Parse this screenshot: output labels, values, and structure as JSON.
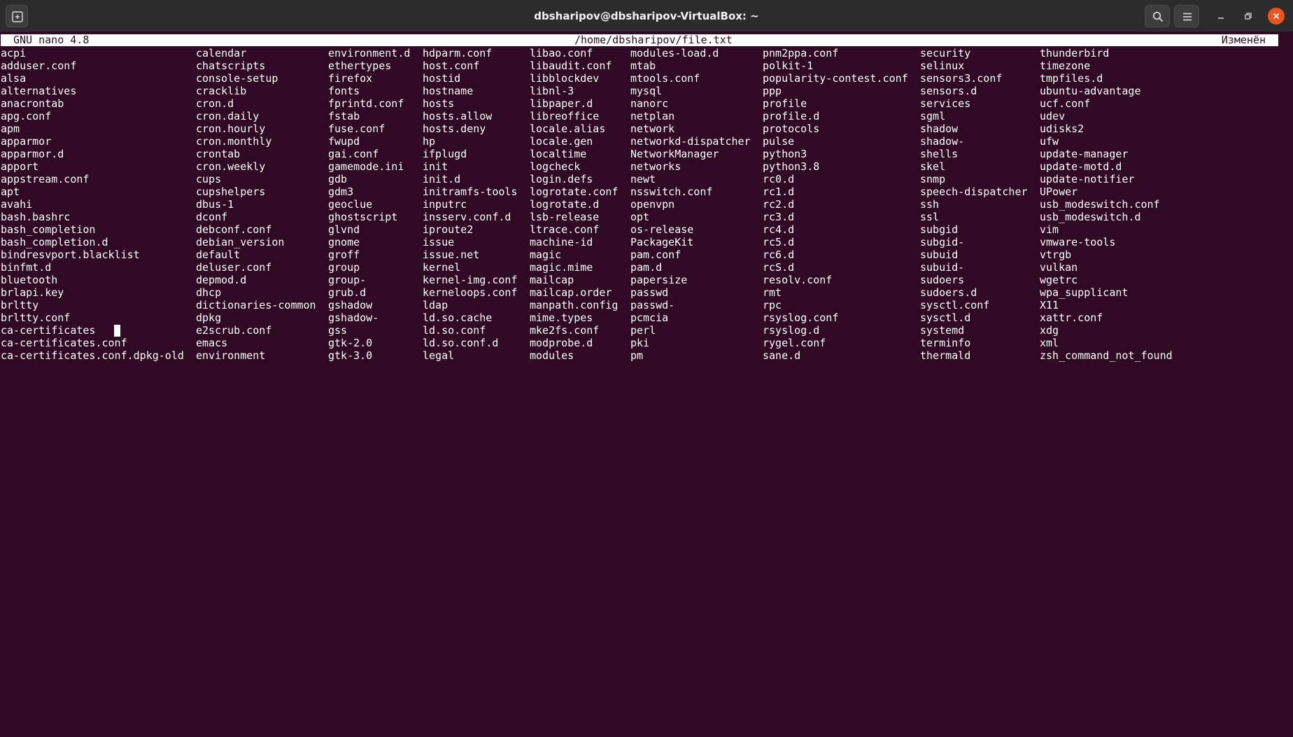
{
  "window": {
    "title": "dbsharipov@dbsharipov-VirtualBox: ~"
  },
  "nano": {
    "version": "GNU nano 4.8",
    "filename": "/home/dbsharipov/file.txt",
    "status": "Изменён"
  },
  "rows": [
    [
      "acpi",
      "calendar",
      "environment.d",
      "hdparm.conf",
      "libao.conf",
      "modules-load.d",
      "pnm2ppa.conf",
      "security",
      "thunderbird"
    ],
    [
      "adduser.conf",
      "chatscripts",
      "ethertypes",
      "host.conf",
      "libaudit.conf",
      "mtab",
      "polkit-1",
      "selinux",
      "timezone"
    ],
    [
      "alsa",
      "console-setup",
      "firefox",
      "hostid",
      "libblockdev",
      "mtools.conf",
      "popularity-contest.conf",
      "sensors3.conf",
      "tmpfiles.d"
    ],
    [
      "alternatives",
      "cracklib",
      "fonts",
      "hostname",
      "libnl-3",
      "mysql",
      "ppp",
      "sensors.d",
      "ubuntu-advantage"
    ],
    [
      "anacrontab",
      "cron.d",
      "fprintd.conf",
      "hosts",
      "libpaper.d",
      "nanorc",
      "profile",
      "services",
      "ucf.conf"
    ],
    [
      "apg.conf",
      "cron.daily",
      "fstab",
      "hosts.allow",
      "libreoffice",
      "netplan",
      "profile.d",
      "sgml",
      "udev"
    ],
    [
      "apm",
      "cron.hourly",
      "fuse.conf",
      "hosts.deny",
      "locale.alias",
      "network",
      "protocols",
      "shadow",
      "udisks2"
    ],
    [
      "apparmor",
      "cron.monthly",
      "fwupd",
      "hp",
      "locale.gen",
      "networkd-dispatcher",
      "pulse",
      "shadow-",
      "ufw"
    ],
    [
      "apparmor.d",
      "crontab",
      "gai.conf",
      "ifplugd",
      "localtime",
      "NetworkManager",
      "python3",
      "shells",
      "update-manager"
    ],
    [
      "apport",
      "cron.weekly",
      "gamemode.ini",
      "init",
      "logcheck",
      "networks",
      "python3.8",
      "skel",
      "update-motd.d"
    ],
    [
      "appstream.conf",
      "cups",
      "gdb",
      "init.d",
      "login.defs",
      "newt",
      "rc0.d",
      "snmp",
      "update-notifier"
    ],
    [
      "apt",
      "cupshelpers",
      "gdm3",
      "initramfs-tools",
      "logrotate.conf",
      "nsswitch.conf",
      "rc1.d",
      "speech-dispatcher",
      "UPower"
    ],
    [
      "avahi",
      "dbus-1",
      "geoclue",
      "inputrc",
      "logrotate.d",
      "openvpn",
      "rc2.d",
      "ssh",
      "usb_modeswitch.conf"
    ],
    [
      "bash.bashrc",
      "dconf",
      "ghostscript",
      "insserv.conf.d",
      "lsb-release",
      "opt",
      "rc3.d",
      "ssl",
      "usb_modeswitch.d"
    ],
    [
      "bash_completion",
      "debconf.conf",
      "glvnd",
      "iproute2",
      "ltrace.conf",
      "os-release",
      "rc4.d",
      "subgid",
      "vim"
    ],
    [
      "bash_completion.d",
      "debian_version",
      "gnome",
      "issue",
      "machine-id",
      "PackageKit",
      "rc5.d",
      "subgid-",
      "vmware-tools"
    ],
    [
      "bindresvport.blacklist",
      "default",
      "groff",
      "issue.net",
      "magic",
      "pam.conf",
      "rc6.d",
      "subuid",
      "vtrgb"
    ],
    [
      "binfmt.d",
      "deluser.conf",
      "group",
      "kernel",
      "magic.mime",
      "pam.d",
      "rcS.d",
      "subuid-",
      "vulkan"
    ],
    [
      "bluetooth",
      "depmod.d",
      "group-",
      "kernel-img.conf",
      "mailcap",
      "papersize",
      "resolv.conf",
      "sudoers",
      "wgetrc"
    ],
    [
      "brlapi.key",
      "dhcp",
      "grub.d",
      "kerneloops.conf",
      "mailcap.order",
      "passwd",
      "rmt",
      "sudoers.d",
      "wpa_supplicant"
    ],
    [
      "brltty",
      "dictionaries-common",
      "gshadow",
      "ldap",
      "manpath.config",
      "passwd-",
      "rpc",
      "sysctl.conf",
      "X11"
    ],
    [
      "brltty.conf",
      "dpkg",
      "gshadow-",
      "ld.so.cache",
      "mime.types",
      "pcmcia",
      "rsyslog.conf",
      "sysctl.d",
      "xattr.conf"
    ],
    [
      "ca-certificates",
      "e2scrub.conf",
      "gss",
      "ld.so.conf",
      "mke2fs.conf",
      "perl",
      "rsyslog.d",
      "systemd",
      "xdg"
    ],
    [
      "ca-certificates.conf",
      "emacs",
      "gtk-2.0",
      "ld.so.conf.d",
      "modprobe.d",
      "pki",
      "rygel.conf",
      "terminfo",
      "xml"
    ],
    [
      "ca-certificates.conf.dpkg-old",
      "environment",
      "gtk-3.0",
      "legal",
      "modules",
      "pm",
      "sane.d",
      "thermald",
      "zsh_command_not_found"
    ]
  ]
}
